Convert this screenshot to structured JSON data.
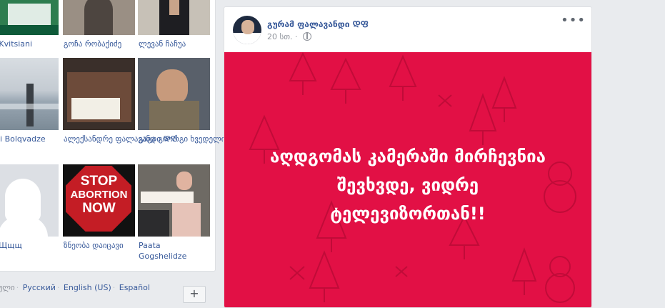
{
  "friends": [
    {
      "name": "ka Kvitsiani"
    },
    {
      "name": "გოჩა რობაქიძე"
    },
    {
      "name": "ლევან ჩაჩუა"
    },
    {
      "name": "orgi Bolqvadze"
    },
    {
      "name": "ალექსანდრე ფალავანდი ᲓᲤ"
    },
    {
      "name": "გაგა გიორგი ხვედელიძე"
    },
    {
      "name": "ცც Щщщ"
    },
    {
      "name": "ზნეობა დაიცავი"
    },
    {
      "name": "Paata Gogshelidze"
    }
  ],
  "stop_sign": {
    "line1": "STOP",
    "line2": "ABORTION",
    "line3": "NOW"
  },
  "languages": [
    "რთული",
    "Русский",
    "English (US)",
    "Español"
  ],
  "plus_label": "+",
  "post": {
    "author": "გურამ ფალავანდი ᲓᲤ",
    "time": "20 სთ.",
    "menu": "•••",
    "banner_lines": [
      "აღდგომას კამერაში მირჩევნია",
      "შევხვდე, ვიდრე",
      "ტელევიზორთან!!"
    ],
    "banner_color": "#e21045"
  }
}
